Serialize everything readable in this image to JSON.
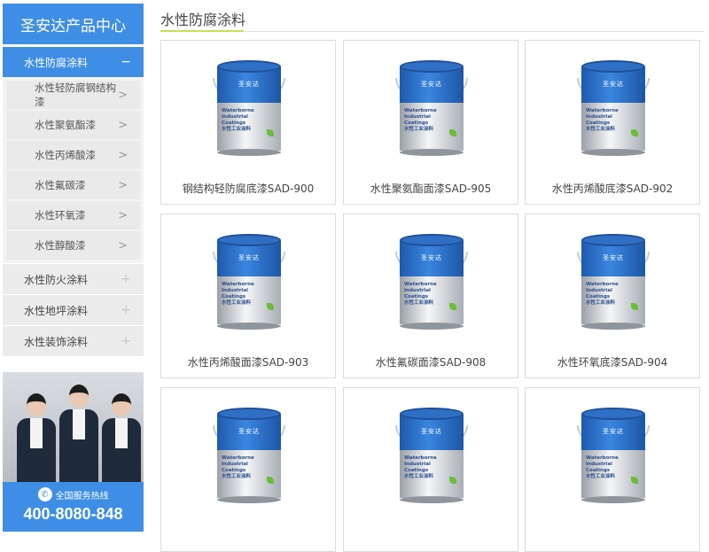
{
  "sidebar": {
    "title": "圣安达产品中心",
    "categories": [
      {
        "label": "水性防腐涂料",
        "sign": "−"
      },
      {
        "label": "水性防火涂料",
        "sign": "+"
      },
      {
        "label": "水性地坪涂料",
        "sign": "+"
      },
      {
        "label": "水性装饰涂料",
        "sign": "+"
      }
    ],
    "subitems": [
      {
        "label": "水性轻防腐钢结构漆"
      },
      {
        "label": "水性聚氨酯漆"
      },
      {
        "label": "水性丙烯酸漆"
      },
      {
        "label": "水性氟碳漆"
      },
      {
        "label": "水性环氧漆"
      },
      {
        "label": "水性醇酸漆"
      }
    ],
    "chevron": ">",
    "hotline_label": "全国服务热线",
    "hotline_number": "400-8080-848"
  },
  "main": {
    "title": "水性防腐涂料",
    "products": [
      {
        "name": "钢结构轻防腐底漆SAD-900"
      },
      {
        "name": "水性聚氨酯面漆SAD-905"
      },
      {
        "name": "水性丙烯酸底漆SAD-902"
      },
      {
        "name": "水性丙烯酸面漆SAD-903"
      },
      {
        "name": "水性氟碳面漆SAD-908"
      },
      {
        "name": "水性环氧底漆SAD-904"
      },
      {
        "name": ""
      },
      {
        "name": ""
      },
      {
        "name": ""
      }
    ],
    "can_label": {
      "brand": "圣安达",
      "line1": "Waterborne Industrial",
      "line2": "Coatings",
      "line3": "水性工业涂料"
    }
  },
  "colors": {
    "accent": "#3e8ee5",
    "underline": "#c8de5a",
    "menu_bg": "#ececec"
  }
}
